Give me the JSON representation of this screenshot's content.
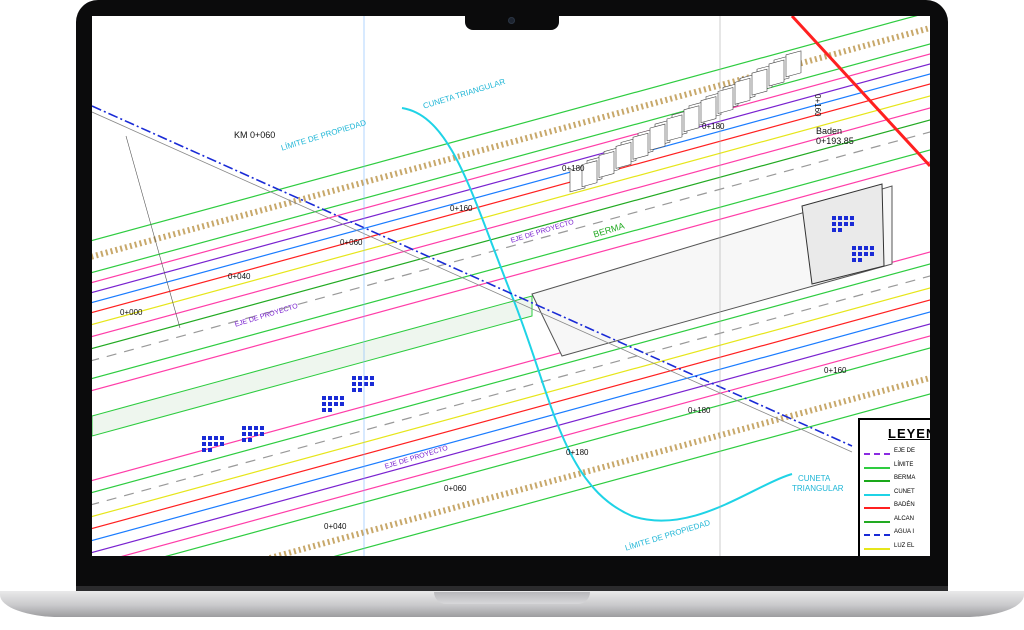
{
  "device": {
    "type": "laptop",
    "camera_icon": "camera-icon"
  },
  "drawing": {
    "chainage_km": "KM 0+060",
    "baden": "Baden",
    "baden_km": "0+193.85",
    "labels": {
      "limite_propiedad": "LÍMITE DE PROPIEDAD",
      "cuneta_triangular": "CUNETA TRIANGULAR",
      "cuneta": "CUNETA",
      "triangular": "TRIANGULAR",
      "eje_proyecto": "EJE DE PROYECTO",
      "berma": "BERMA"
    },
    "stations": [
      "0+000",
      "0+040",
      "0+060",
      "0+160",
      "0+180",
      "0+040",
      "0+060",
      "0+180",
      "0+160",
      "0+180",
      "0+160",
      "0+180"
    ]
  },
  "legend": {
    "title": "LEYEND",
    "items": [
      {
        "label": "EJE DE",
        "color": "#8a2be2"
      },
      {
        "label": "LÍMITE",
        "color": "#2ecc40"
      },
      {
        "label": "BERMA",
        "color": "#1aa81a"
      },
      {
        "label": "CUNET",
        "color": "#1fd3e6"
      },
      {
        "label": "BADÉN",
        "color": "#ff2020"
      },
      {
        "label": "ALCAN",
        "color": "#22aa22"
      },
      {
        "label": "AGUA I",
        "color": "#1a2bd6"
      },
      {
        "label": "LUZ EL",
        "color": "#e6e61a"
      }
    ]
  }
}
